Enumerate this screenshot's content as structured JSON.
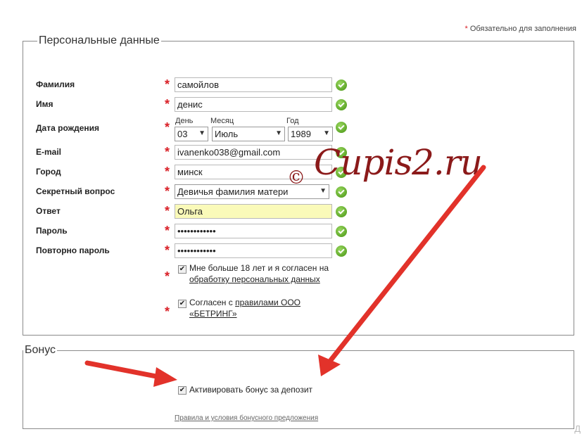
{
  "required_note": "Обязательно для заполнения",
  "required_star": "*",
  "personal": {
    "legend": "Персональные данные",
    "fields": {
      "lastname": {
        "label": "Фамилия",
        "value": "самойлов"
      },
      "firstname": {
        "label": "Имя",
        "value": "денис"
      },
      "birthdate": {
        "label": "Дата рождения",
        "day_label": "День",
        "day_value": "03",
        "month_label": "Месяц",
        "month_value": "Июль",
        "year_label": "Год",
        "year_value": "1989"
      },
      "email": {
        "label": "E-mail",
        "value": "ivanenko038@gmail.com"
      },
      "city": {
        "label": "Город",
        "value": "минск"
      },
      "secret_question": {
        "label": "Секретный вопрос",
        "value": "Девичья фамилия матери"
      },
      "answer": {
        "label": "Ответ",
        "value": "Ольга"
      },
      "password": {
        "label": "Пароль",
        "value": "••••••••••••"
      },
      "password_repeat": {
        "label": "Повторно пароль",
        "value": "••••••••••••"
      }
    },
    "agree_age": {
      "text": "Мне больше 18 лет и я согласен на",
      "link": "обработку персональных данных",
      "checked": true
    },
    "agree_rules": {
      "text": "Согласен с",
      "link_part1": "правилами ООО",
      "link_part2": "«БЕТРИНГ»",
      "checked": true
    }
  },
  "bonus": {
    "legend": "Бонус",
    "activate_label": "Активировать бонус за депозит",
    "activate_checked": true,
    "terms_link": "Правила и условия бонусного предложения"
  },
  "watermark": {
    "copyright": "©",
    "text": "Cupis2.ru"
  },
  "colors": {
    "required": "#d92027",
    "ok": "#5ea728",
    "arrow": "#e2322a",
    "watermark": "#8b1a1a",
    "answer_bg": "#fafab9"
  },
  "icons": {
    "ok": "checkmark-circle-icon",
    "select": "dropdown-arrow-icon"
  }
}
